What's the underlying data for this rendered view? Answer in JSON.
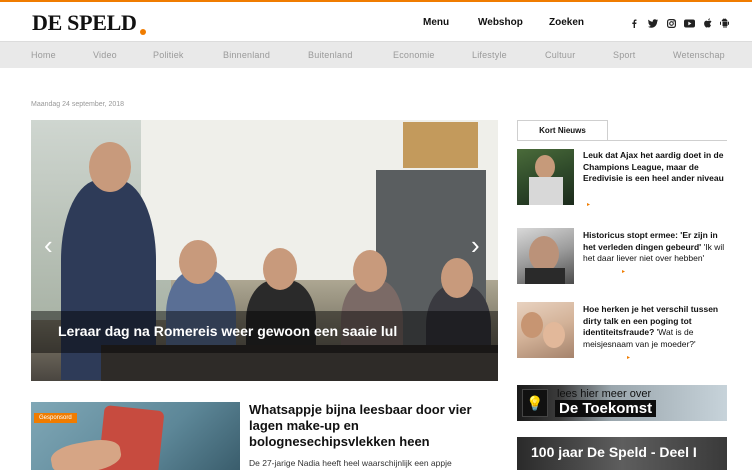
{
  "header": {
    "logo_text": "DE SPELD",
    "nav": [
      "Menu",
      "Webshop",
      "Zoeken"
    ],
    "social_icons": [
      "facebook-icon",
      "twitter-icon",
      "instagram-icon",
      "youtube-icon",
      "apple-icon",
      "android-icon"
    ]
  },
  "categories": [
    "Home",
    "Video",
    "Politiek",
    "Binnenland",
    "Buitenland",
    "Economie",
    "Lifestyle",
    "Cultuur",
    "Sport",
    "Wetenschap"
  ],
  "date": "Maandag 24 september, 2018",
  "hero": {
    "caption": "Leraar dag na Romereis weer gewoon een saaie lul",
    "prev_glyph": "‹",
    "next_glyph": "›"
  },
  "article": {
    "tag": "Gesponsord",
    "title": "Whatsappje bijna leesbaar door vier lagen make-up en bolognesechipsvlekken heen",
    "lead": "De 27-jarige Nadia heeft heel waarschijnlijk een appje"
  },
  "kort_nieuws": {
    "tab_label": "Kort Nieuws",
    "more_glyph": "▸",
    "items": [
      {
        "title": "Leuk dat Ajax het aardig doet in de Champions League, maar de Eredivisie is een heel ander niveau",
        "sub": ""
      },
      {
        "title": "Historicus stopt ermee: 'Er zijn in het verleden dingen gebeurd'",
        "sub": "'Ik wil het daar liever niet over hebben'"
      },
      {
        "title": "Hoe herken je het verschil tussen dirty talk en een poging tot identiteitsfraude?",
        "sub": "'Wat is de meisjesnaam van je moeder?'"
      }
    ]
  },
  "promos": {
    "promo1_line1": "lees hier meer over",
    "promo1_line2": "De Toekomst",
    "promo2": "100 jaar De Speld - Deel I"
  },
  "colors": {
    "accent": "#f07c00",
    "category_bar": "#e9e9e9"
  }
}
